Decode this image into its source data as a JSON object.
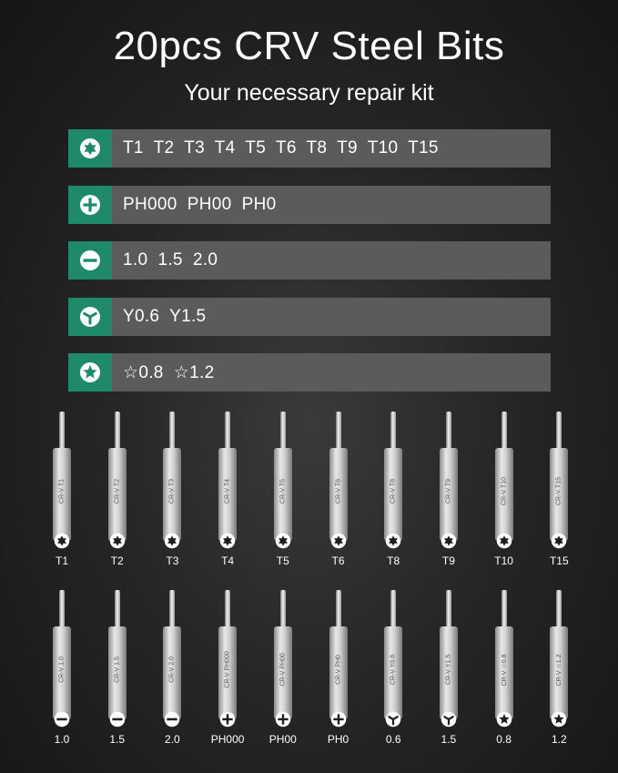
{
  "header": {
    "title": "20pcs CRV Steel Bits",
    "subtitle": "Your necessary repair kit"
  },
  "categories": [
    {
      "icon": "torx-icon",
      "label": "T1  T2  T3  T4  T5  T6  T8  T9  T10  T15"
    },
    {
      "icon": "phillips-icon",
      "label": "PH000  PH00  PH0"
    },
    {
      "icon": "slotted-icon",
      "label": "1.0  1.5  2.0"
    },
    {
      "icon": "tri-wing-icon",
      "label": "Y0.6  Y1.5"
    },
    {
      "icon": "pentalobe-icon",
      "label": "☆0.8  ☆1.2"
    }
  ],
  "bits_row1": [
    {
      "label": "T1",
      "engrave": "CR-V  T1",
      "icon": "torx-icon"
    },
    {
      "label": "T2",
      "engrave": "CR-V  T2",
      "icon": "torx-icon"
    },
    {
      "label": "T3",
      "engrave": "CR-V  T3",
      "icon": "torx-icon"
    },
    {
      "label": "T4",
      "engrave": "CR-V  T4",
      "icon": "torx-icon"
    },
    {
      "label": "T5",
      "engrave": "CR-V  T5",
      "icon": "torx-icon"
    },
    {
      "label": "T6",
      "engrave": "CR-V  T6",
      "icon": "torx-icon"
    },
    {
      "label": "T8",
      "engrave": "CR-V  T8",
      "icon": "torx-icon"
    },
    {
      "label": "T9",
      "engrave": "CR-V  T9",
      "icon": "torx-icon"
    },
    {
      "label": "T10",
      "engrave": "CR-V  T10",
      "icon": "torx-icon"
    },
    {
      "label": "T15",
      "engrave": "CR-V  T15",
      "icon": "torx-icon"
    }
  ],
  "bits_row2": [
    {
      "label": "1.0",
      "engrave": "CR-V  1.0",
      "icon": "slotted-icon"
    },
    {
      "label": "1.5",
      "engrave": "CR-V  1.5",
      "icon": "slotted-icon"
    },
    {
      "label": "2.0",
      "engrave": "CR-V  2.0",
      "icon": "slotted-icon"
    },
    {
      "label": "PH000",
      "engrave": "CR-V  PH000",
      "icon": "phillips-icon"
    },
    {
      "label": "PH00",
      "engrave": "CR-V  PH00",
      "icon": "phillips-icon"
    },
    {
      "label": "PH0",
      "engrave": "CR-V  PH0",
      "icon": "phillips-icon"
    },
    {
      "label": "0.6",
      "engrave": "CR-V  Y0.6",
      "icon": "tri-wing-icon"
    },
    {
      "label": "1.5",
      "engrave": "CR-V  Y1.5",
      "icon": "tri-wing-icon"
    },
    {
      "label": "0.8",
      "engrave": "CR-V  ☆0.8",
      "icon": "pentalobe-icon"
    },
    {
      "label": "1.2",
      "engrave": "CR-V  ☆1.2",
      "icon": "pentalobe-icon"
    }
  ],
  "colors": {
    "accent": "#1f8a6a",
    "bar": "#5b5b5b"
  }
}
